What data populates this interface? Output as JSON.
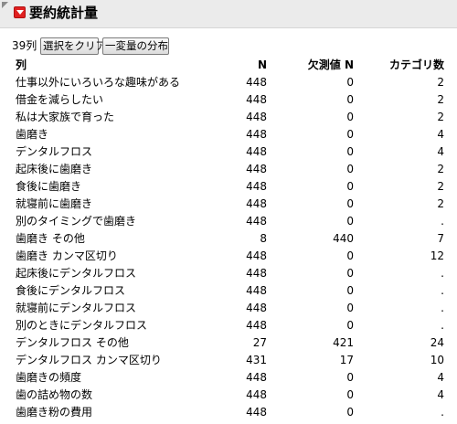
{
  "panel": {
    "title": "要約統計量"
  },
  "toolbar": {
    "column_count": "39列",
    "clear_selection_label": "選択をクリア",
    "distribution_label": "一変量の分布"
  },
  "table": {
    "headers": [
      "列",
      "N",
      "欠測値 N",
      "カテゴリ数"
    ],
    "rows": [
      [
        "仕事以外にいろいろな趣味がある",
        "448",
        "0",
        "2"
      ],
      [
        "借金を減らしたい",
        "448",
        "0",
        "2"
      ],
      [
        "私は大家族で育った",
        "448",
        "0",
        "2"
      ],
      [
        "歯磨き",
        "448",
        "0",
        "4"
      ],
      [
        "デンタルフロス",
        "448",
        "0",
        "4"
      ],
      [
        "起床後に歯磨き",
        "448",
        "0",
        "2"
      ],
      [
        "食後に歯磨き",
        "448",
        "0",
        "2"
      ],
      [
        "就寝前に歯磨き",
        "448",
        "0",
        "2"
      ],
      [
        "別のタイミングで歯磨き",
        "448",
        "0",
        "."
      ],
      [
        "歯磨き その他",
        "8",
        "440",
        "7"
      ],
      [
        "歯磨き カンマ区切り",
        "448",
        "0",
        "12"
      ],
      [
        "起床後にデンタルフロス",
        "448",
        "0",
        "."
      ],
      [
        "食後にデンタルフロス",
        "448",
        "0",
        "."
      ],
      [
        "就寝前にデンタルフロス",
        "448",
        "0",
        "."
      ],
      [
        "別のときにデンタルフロス",
        "448",
        "0",
        "."
      ],
      [
        "デンタルフロス その他",
        "27",
        "421",
        "24"
      ],
      [
        "デンタルフロス カンマ区切り",
        "431",
        "17",
        "10"
      ],
      [
        "歯磨きの頻度",
        "448",
        "0",
        "4"
      ],
      [
        "歯の詰め物の数",
        "448",
        "0",
        "4"
      ],
      [
        "歯磨き粉の費用",
        "448",
        "0",
        "."
      ]
    ]
  },
  "icons": {
    "hotspot": "red-triangle-menu-icon",
    "outline": "collapse-corner-icon"
  },
  "colors": {
    "hotspot": "#e02020",
    "header_bg": "#ebebeb"
  }
}
